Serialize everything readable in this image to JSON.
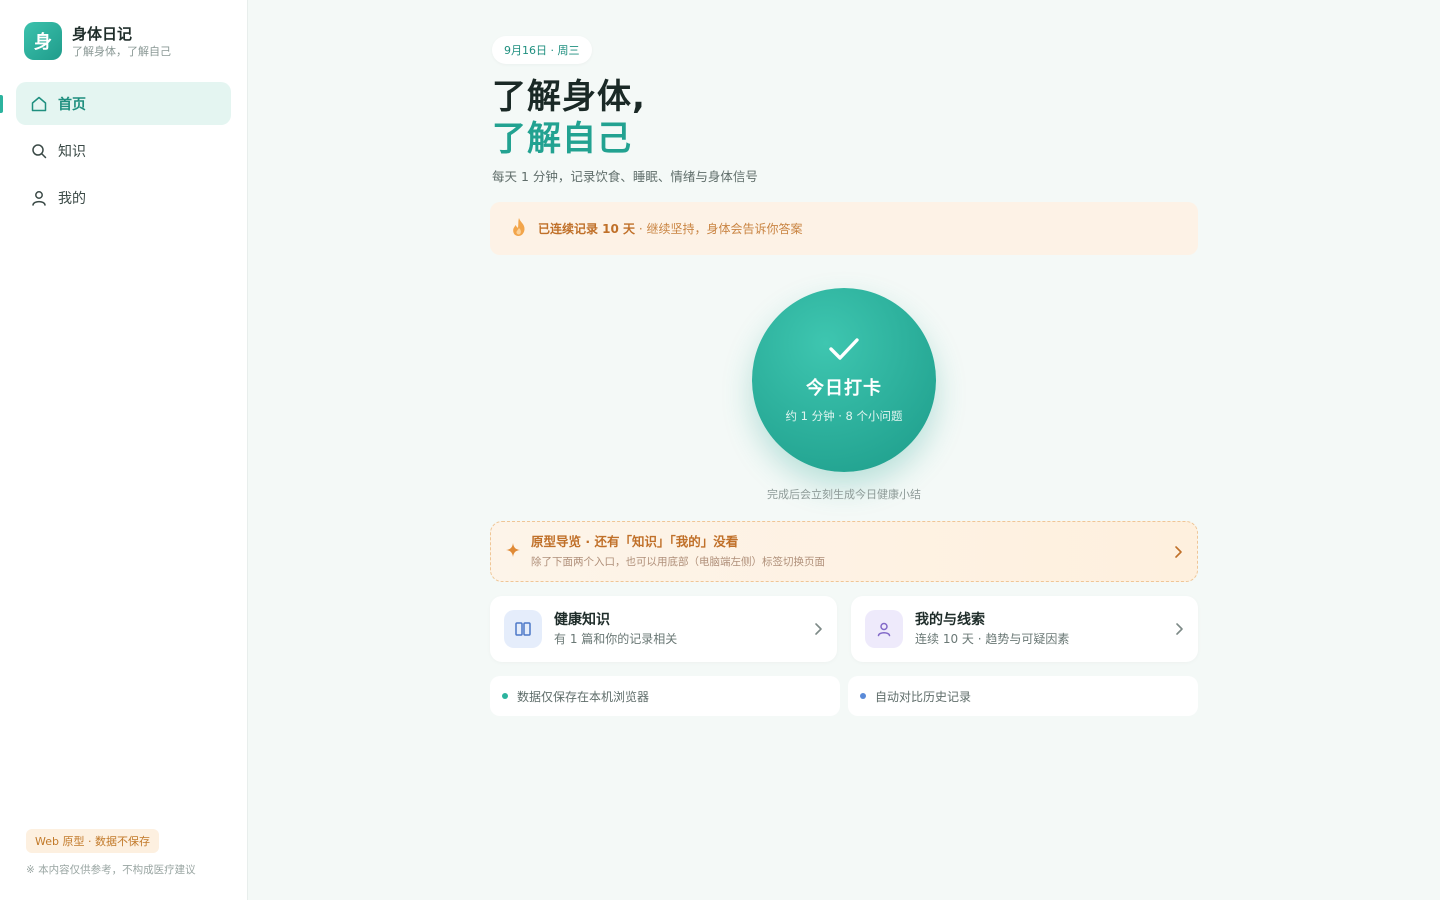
{
  "brand": {
    "logo_char": "身",
    "title": "身体日记",
    "subtitle": "了解身体，了解自己"
  },
  "nav": [
    {
      "label": "首页",
      "icon": "home-icon",
      "active": true
    },
    {
      "label": "知识",
      "icon": "search-icon",
      "active": false
    },
    {
      "label": "我的",
      "icon": "user-icon",
      "active": false
    }
  ],
  "sidebar_footer": {
    "badge": "Web 原型 · 数据不保存",
    "disclaimer": "※ 本内容仅供参考，不构成医疗建议"
  },
  "main": {
    "date": "9月16日 · 周三",
    "headline_line1": "了解身体,",
    "headline_line2": "了解自己",
    "subline": "每天 1 分钟，记录饮食、睡眠、情绪与身体信号",
    "streak": {
      "strong": "已连续记录 10 天",
      "rest": " · 继续坚持，身体会告诉你答案"
    },
    "checkin": {
      "title": "今日打卡",
      "subtitle": "约 1 分钟 · 8 个小问题",
      "note": "完成后会立刻生成今日健康小结"
    },
    "guide": {
      "title": "原型导览 · 还有「知识」「我的」没看",
      "subtitle": "除了下面两个入口，也可以用底部（电脑端左侧）标签切换页面"
    },
    "cards": [
      {
        "title": "健康知识",
        "subtitle": "有 1 篇和你的记录相关",
        "icon": "book-icon"
      },
      {
        "title": "我的与线索",
        "subtitle": "连续 10 天 · 趋势与可疑因素",
        "icon": "user-icon"
      }
    ],
    "info": [
      {
        "text": "数据仅保存在本机浏览器"
      },
      {
        "text": "自动对比历史记录"
      }
    ]
  },
  "colors": {
    "accent": "#22a291",
    "accent_light": "#e4f5f1",
    "warm": "#c07029",
    "warm_bg": "#fdf2e6"
  }
}
